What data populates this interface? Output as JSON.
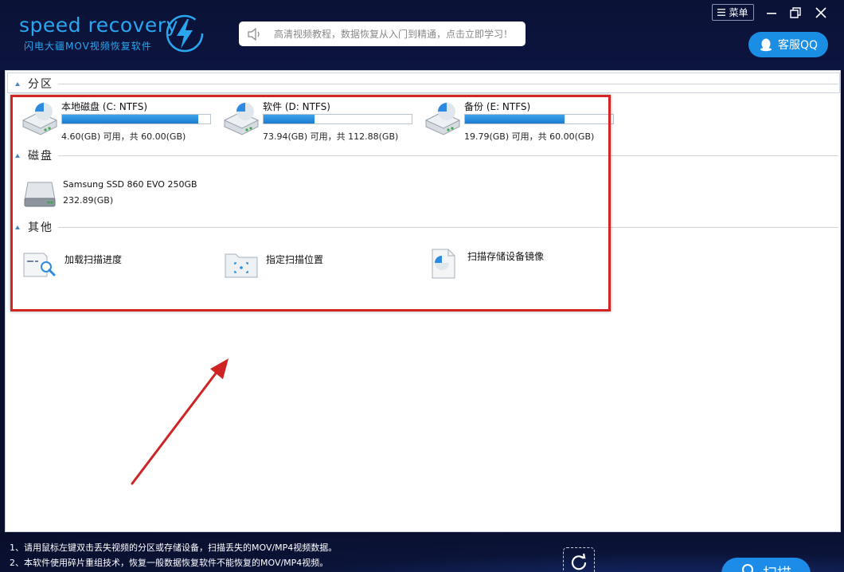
{
  "brand": {
    "name": "speed recovery",
    "subtitle": "闪电大疆MOV视频恢复软件"
  },
  "notice": {
    "text": "高清视频教程，数据恢复从入门到精通，点击立即学习！"
  },
  "header": {
    "menu_label": "菜单",
    "qq_label": "客服QQ"
  },
  "sections": {
    "partitions": "分区",
    "disks": "磁盘",
    "other": "其他"
  },
  "partitions": [
    {
      "name": "本地磁盘 (C: NTFS)",
      "capacity": "4.60(GB) 可用，共 60.00(GB)",
      "used_fraction": 0.92
    },
    {
      "name": "软件 (D: NTFS)",
      "capacity": "73.94(GB) 可用，共 112.88(GB)",
      "used_fraction": 0.345
    },
    {
      "name": "备份 (E: NTFS)",
      "capacity": "19.79(GB) 可用，共 60.00(GB)",
      "used_fraction": 0.67
    }
  ],
  "disks": [
    {
      "name": "Samsung SSD 860 EVO 250GB",
      "capacity": "232.89(GB)"
    }
  ],
  "other": [
    {
      "label": "加载扫描进度",
      "icon": "load-progress-icon"
    },
    {
      "label": "指定扫描位置",
      "icon": "folder-target-icon"
    },
    {
      "label": "扫描存储设备镜像",
      "icon": "disk-image-icon"
    }
  ],
  "footer": {
    "tip1": "1、请用鼠标左键双击丢失视频的分区或存储设备，扫描丢失的MOV/MP4视频数据。",
    "tip2": "2、本软件使用碎片重组技术，恢复一般数据恢复软件不能恢复的MOV/MP4视频。",
    "scan_label": "扫描"
  },
  "colors": {
    "header_bg": "#0b1236",
    "brand_blue": "#2aa6f0",
    "bar_fill": "#1a7bd0",
    "highlight_red": "#d42525",
    "qq_button": "#1a8ee3"
  }
}
